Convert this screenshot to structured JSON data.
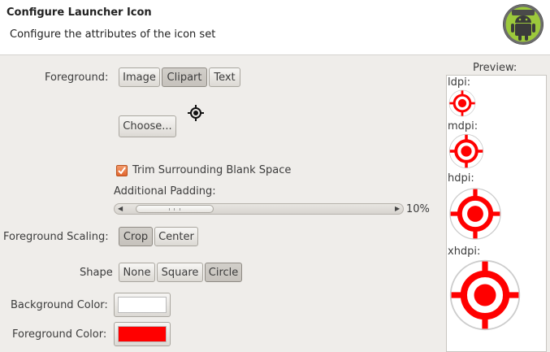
{
  "header": {
    "title": "Configure Launcher Icon",
    "description": "Configure the attributes of the icon set",
    "logo_icon": "android-logo-icon"
  },
  "foreground": {
    "label": "Foreground:",
    "options": [
      "Image",
      "Clipart",
      "Text"
    ],
    "selected": "Clipart",
    "clipart_icon": "crosshair-target-icon",
    "choose_label": "Choose..."
  },
  "trim": {
    "label": "Trim Surrounding Blank Space",
    "checked": true
  },
  "padding": {
    "label": "Additional Padding:",
    "value_text": "10%",
    "value": 10
  },
  "scaling": {
    "label": "Foreground Scaling:",
    "options": [
      "Crop",
      "Center"
    ],
    "selected": "Crop"
  },
  "shape": {
    "label": "Shape",
    "options": [
      "None",
      "Square",
      "Circle"
    ],
    "selected": "Circle"
  },
  "background_color": {
    "label": "Background Color:",
    "color": "#ffffff"
  },
  "foreground_color": {
    "label": "Foreground Color:",
    "color": "#ff0000"
  },
  "preview": {
    "title": "Preview:",
    "densities": [
      "ldpi:",
      "mdpi:",
      "hdpi:",
      "xhdpi:"
    ]
  }
}
